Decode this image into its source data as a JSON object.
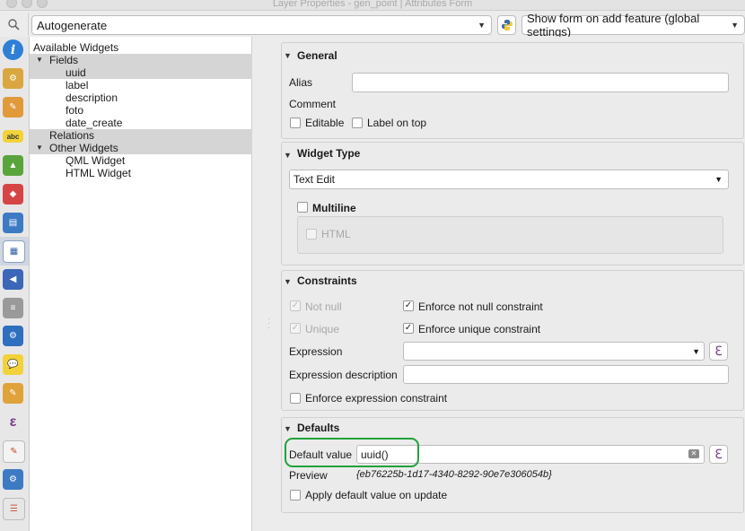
{
  "window": {
    "title": "Layer Properties - gen_point | Attributes Form"
  },
  "top": {
    "layout_value": "Autogenerate",
    "suppress_value": "Show form on add feature (global settings)"
  },
  "toolbar_icons": [
    "information-icon",
    "source-icon",
    "symbology-icon",
    "labels-icon",
    "3d-view-icon",
    "diagrams-icon",
    "fields-icon",
    "attributes-form-icon",
    "joins-icon",
    "auxiliary-storage-icon",
    "actions-icon",
    "display-icon",
    "rendering-icon",
    "variables-icon",
    "metadata-icon",
    "dependencies-icon",
    "legend-icon"
  ],
  "tree": {
    "available_widgets": "Available Widgets",
    "fields": "Fields",
    "field_items": [
      "uuid",
      "label",
      "description",
      "foto",
      "date_create"
    ],
    "relations": "Relations",
    "other_widgets": "Other Widgets",
    "other_items": [
      "QML Widget",
      "HTML Widget"
    ]
  },
  "general": {
    "title": "General",
    "alias_label": "Alias",
    "alias_value": "",
    "comment_label": "Comment",
    "editable_label": "Editable",
    "label_on_top": "Label on top"
  },
  "widget_type": {
    "title": "Widget Type",
    "value": "Text Edit",
    "multiline_label": "Multiline",
    "html_label": "HTML"
  },
  "constraints": {
    "title": "Constraints",
    "not_null": "Not null",
    "unique": "Unique",
    "enforce_not_null": "Enforce not null constraint",
    "enforce_unique": "Enforce unique constraint",
    "expression_label": "Expression",
    "expression_value": "",
    "expression_desc_label": "Expression description",
    "expression_desc_value": "",
    "enforce_expression": "Enforce expression constraint"
  },
  "defaults": {
    "title": "Defaults",
    "default_value_label": "Default value",
    "default_value": "uuid()",
    "preview_label": "Preview",
    "preview_value": "{eb76225b-1d17-4340-8292-90e7e306054b}",
    "apply_on_update": "Apply default value on update"
  },
  "colors": {
    "highlight": "#1fa33a",
    "expression_icon": "#7a3d8b"
  }
}
